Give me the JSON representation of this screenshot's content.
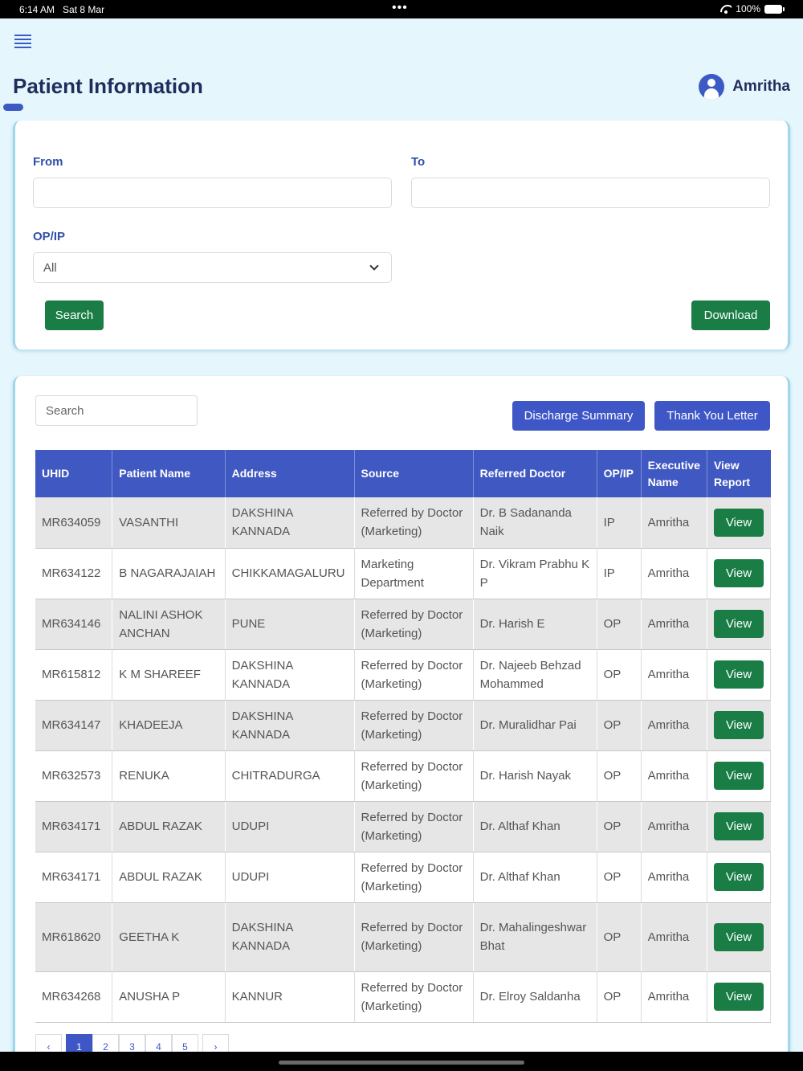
{
  "status_bar": {
    "time": "6:14 AM",
    "date": "Sat 8 Mar",
    "dots": "•••",
    "battery": "100%"
  },
  "header": {
    "title": "Patient Information",
    "user_name": "Amritha"
  },
  "filters": {
    "from_label": "From",
    "from_value": "",
    "to_label": "To",
    "to_value": "",
    "opip_label": "OP/IP",
    "opip_selected": "All",
    "search_label": "Search",
    "download_label": "Download"
  },
  "table_controls": {
    "search_placeholder": "Search",
    "discharge_label": "Discharge Summary",
    "thankyou_label": "Thank You Letter"
  },
  "table": {
    "columns": [
      "UHID",
      "Patient Name",
      "Address",
      "Source",
      "Referred Doctor",
      "OP/IP",
      "Executive Name",
      "View Report"
    ],
    "view_label": "View",
    "rows": [
      {
        "uhid": "MR634059",
        "name": "VASANTHI",
        "address": "DAKSHINA KANNADA",
        "source": "Referred by Doctor (Marketing)",
        "doctor": "Dr. B Sadananda Naik",
        "opip": "IP",
        "exec": "Amritha"
      },
      {
        "uhid": "MR634122",
        "name": "B NAGARAJAIAH",
        "address": "CHIKKAMAGALURU",
        "source": "Marketing Department",
        "doctor": "Dr. Vikram Prabhu K P",
        "opip": "IP",
        "exec": "Amritha"
      },
      {
        "uhid": "MR634146",
        "name": "NALINI ASHOK ANCHAN",
        "address": "PUNE",
        "source": "Referred by Doctor (Marketing)",
        "doctor": "Dr. Harish E",
        "opip": "OP",
        "exec": "Amritha"
      },
      {
        "uhid": "MR615812",
        "name": "K M SHAREEF",
        "address": "DAKSHINA KANNADA",
        "source": "Referred by Doctor (Marketing)",
        "doctor": "Dr. Najeeb Behzad Mohammed",
        "opip": "OP",
        "exec": "Amritha"
      },
      {
        "uhid": "MR634147",
        "name": "KHADEEJA",
        "address": "DAKSHINA KANNADA",
        "source": "Referred by Doctor (Marketing)",
        "doctor": "Dr. Muralidhar Pai",
        "opip": "OP",
        "exec": "Amritha"
      },
      {
        "uhid": "MR632573",
        "name": "RENUKA",
        "address": "CHITRADURGA",
        "source": "Referred by Doctor (Marketing)",
        "doctor": "Dr. Harish Nayak",
        "opip": "OP",
        "exec": "Amritha"
      },
      {
        "uhid": "MR634171",
        "name": "ABDUL RAZAK",
        "address": "UDUPI",
        "source": "Referred by Doctor (Marketing)",
        "doctor": "Dr. Althaf Khan",
        "opip": "OP",
        "exec": "Amritha"
      },
      {
        "uhid": "MR634171",
        "name": "ABDUL RAZAK",
        "address": "UDUPI",
        "source": "Referred by Doctor (Marketing)",
        "doctor": "Dr. Althaf Khan",
        "opip": "OP",
        "exec": "Amritha"
      },
      {
        "uhid": "MR618620",
        "name": "GEETHA K",
        "address": "DAKSHINA KANNADA",
        "source": "Referred by Doctor (Marketing)",
        "doctor": "Dr. Mahalingeshwar Bhat",
        "opip": "OP",
        "exec": "Amritha"
      },
      {
        "uhid": "MR634268",
        "name": "ANUSHA P",
        "address": "KANNUR",
        "source": "Referred by Doctor (Marketing)",
        "doctor": "Dr. Elroy Saldanha",
        "opip": "OP",
        "exec": "Amritha"
      }
    ]
  },
  "pagination": {
    "prev": "‹",
    "pages": [
      "1",
      "2",
      "3",
      "4",
      "5"
    ],
    "next": "›",
    "current": "1"
  },
  "colors": {
    "primary": "#3f57c6",
    "success": "#1a7d45",
    "background": "#e6f6fd",
    "title": "#1f2d5c"
  }
}
